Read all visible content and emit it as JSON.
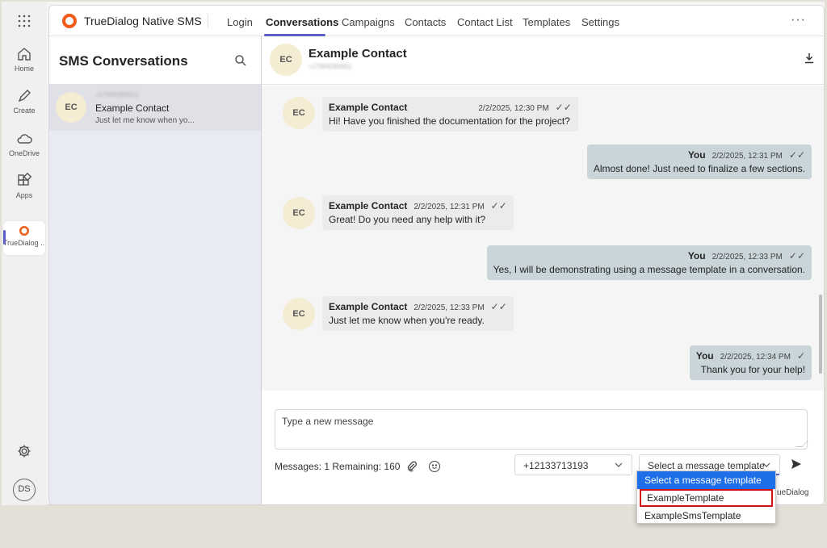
{
  "rail": {
    "items": [
      {
        "label": "Home",
        "icon": "home-icon"
      },
      {
        "label": "Create",
        "icon": "pen-icon"
      },
      {
        "label": "OneDrive",
        "icon": "cloud-icon"
      },
      {
        "label": "Apps",
        "icon": "apps-icon"
      },
      {
        "label": "TrueDialog ...",
        "icon": "truedialog-icon"
      }
    ],
    "user_initials": "DS"
  },
  "topnav": {
    "brand": "TrueDialog Native SMS",
    "items": [
      "Login",
      "Conversations",
      "Campaigns",
      "Contacts",
      "Contact List",
      "Templates",
      "Settings"
    ],
    "active": "Conversations",
    "more": "···"
  },
  "convlist": {
    "title": "SMS Conversations",
    "items": [
      {
        "initials": "EC",
        "phone": "+17604283551",
        "name": "Example Contact",
        "preview": "Just let me know when yo..."
      }
    ]
  },
  "chat": {
    "initials": "EC",
    "title": "Example Contact",
    "subtitle": "+17604283551",
    "messages": [
      {
        "dir": "in",
        "who": "Example Contact",
        "time": "2/2/2025, 12:30 PM",
        "text": "Hi! Have you finished the documentation for the project?"
      },
      {
        "dir": "out",
        "who": "You",
        "time": "2/2/2025, 12:31 PM",
        "text": "Almost done! Just need to finalize a few sections."
      },
      {
        "dir": "in",
        "who": "Example Contact",
        "time": "2/2/2025, 12:31 PM",
        "text": "Great! Do you need any help with it?"
      },
      {
        "dir": "out",
        "who": "You",
        "time": "2/2/2025, 12:33 PM",
        "text": "Yes, I will be demonstrating using a message template in a conversation."
      },
      {
        "dir": "in",
        "who": "Example Contact",
        "time": "2/2/2025, 12:33 PM",
        "text": "Just let me know when you're ready."
      },
      {
        "dir": "out",
        "who": "You",
        "time": "2/2/2025, 12:34 PM",
        "text": "Thank you for your help!"
      }
    ],
    "composer_placeholder": "Type a new message",
    "counter": "Messages: 1 Remaining: 160",
    "from_number": "+12133713193",
    "template_select": "Select a message template",
    "powered": "ueDialog"
  },
  "dropdown": {
    "options": [
      "Select a message template",
      "ExampleTemplate",
      "ExampleSmsTemplate"
    ],
    "selected": 0,
    "highlighted": 1
  },
  "colors": {
    "accent": "#5b5fc7",
    "brand": "#f25c19",
    "highlight_border": "#d31414",
    "selected_option": "#1f6feb"
  }
}
